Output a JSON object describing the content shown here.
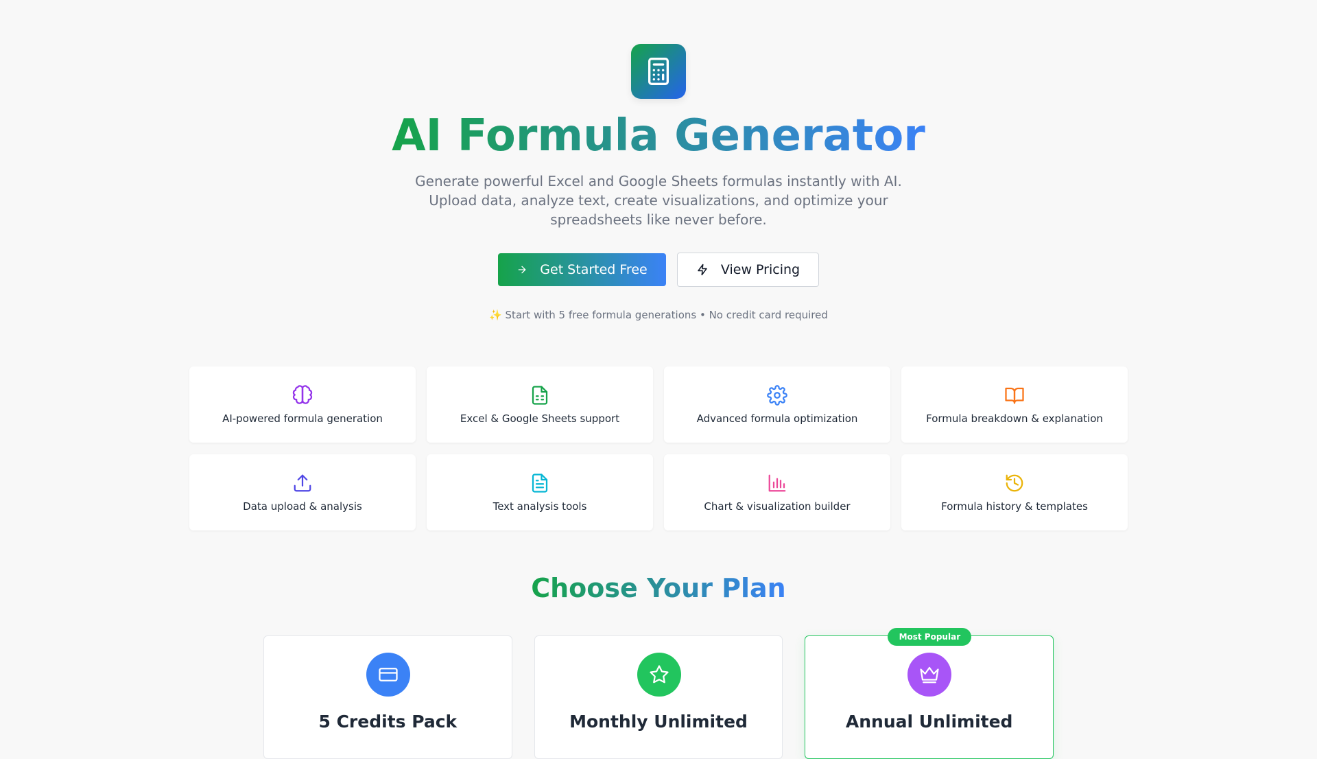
{
  "hero": {
    "title": "AI Formula Generator",
    "subtitle": "Generate powerful Excel and Google Sheets formulas instantly with AI. Upload data, analyze text, create visualizations, and optimize your spreadsheets like never before.",
    "primary_button": "Get Started Free",
    "secondary_button": "View Pricing",
    "note": "✨ Start with 5 free formula generations • No credit card required",
    "logo_icon": "calculator-icon"
  },
  "features": [
    {
      "label": "AI-powered formula generation",
      "icon": "brain-icon",
      "color": "#9333ea"
    },
    {
      "label": "Excel & Google Sheets support",
      "icon": "spreadsheet-icon",
      "color": "#16a34a"
    },
    {
      "label": "Advanced formula optimization",
      "icon": "gear-icon",
      "color": "#3b82f6"
    },
    {
      "label": "Formula breakdown & explanation",
      "icon": "book-icon",
      "color": "#f97316"
    },
    {
      "label": "Data upload & analysis",
      "icon": "upload-icon",
      "color": "#4f46e5"
    },
    {
      "label": "Text analysis tools",
      "icon": "document-icon",
      "color": "#06b6d4"
    },
    {
      "label": "Chart & visualization builder",
      "icon": "bar-chart-icon",
      "color": "#ec4899"
    },
    {
      "label": "Formula history & templates",
      "icon": "history-icon",
      "color": "#eab308"
    }
  ],
  "pricing": {
    "title": "Choose Your Plan",
    "plans": [
      {
        "name": "5 Credits Pack",
        "icon": "credit-card-icon",
        "color": "#3b82f6"
      },
      {
        "name": "Monthly Unlimited",
        "icon": "star-icon",
        "color": "#22c55e"
      },
      {
        "name": "Annual Unlimited",
        "icon": "crown-icon",
        "color": "#a855f7",
        "badge": "Most Popular"
      }
    ]
  }
}
